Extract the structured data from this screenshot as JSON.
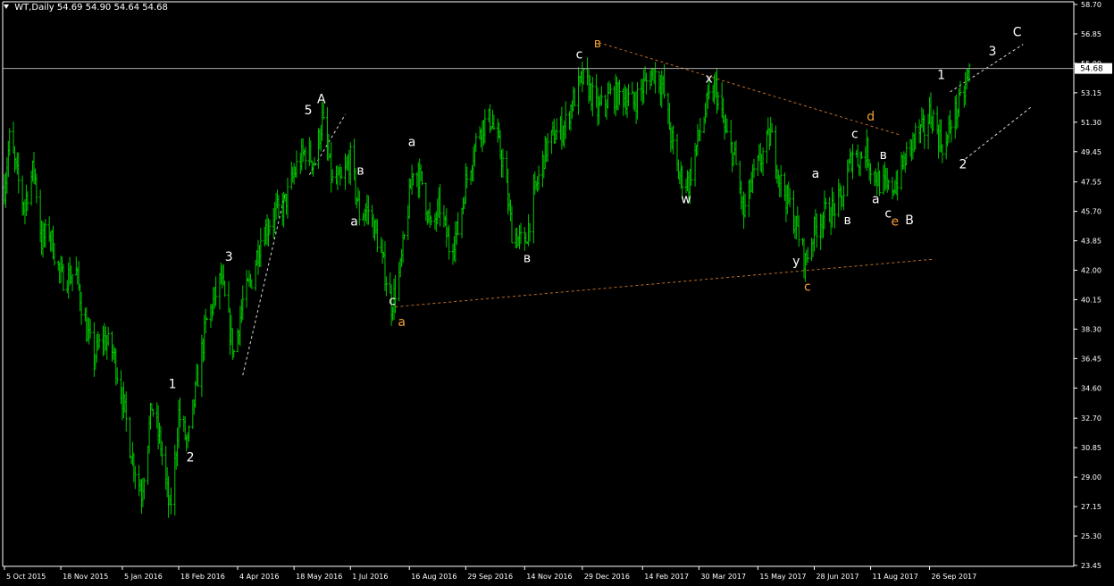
{
  "header": {
    "symbol": "WT,Daily",
    "quote": "54.69 54.90 54.64 54.68"
  },
  "current_price": {
    "label": "54.68",
    "value": 54.68
  },
  "colors": {
    "background": "#000000",
    "candles": "#00c800",
    "axis": "#ffffff",
    "text": "#ffffff",
    "wave_white": "#ffffff",
    "wave_orange": "#f0a030",
    "orange_trend": "#e08030"
  },
  "chart_data": {
    "type": "line",
    "title": "",
    "xlabel": "",
    "ylabel": "",
    "ylim": [
      23.45,
      58.7
    ],
    "y_ticks": [
      58.7,
      56.85,
      55.0,
      53.15,
      51.3,
      49.45,
      47.55,
      45.7,
      43.85,
      42.0,
      40.15,
      38.3,
      36.45,
      34.6,
      32.7,
      30.85,
      29.0,
      27.15,
      25.3,
      23.45
    ],
    "y_tick_labels": [
      "58.70",
      "56.85",
      "55.00",
      "53.15",
      "51.30",
      "49.45",
      "47.55",
      "45.70",
      "43.85",
      "42.00",
      "40.15",
      "38.30",
      "36.45",
      "34.60",
      "32.70",
      "30.85",
      "29.00",
      "27.15",
      "25.30",
      "23.45"
    ],
    "x_ticks": [
      "2015-10-05",
      "2015-11-18",
      "2016-01-05",
      "2016-02-18",
      "2016-04-04",
      "2016-05-18",
      "2016-07-01",
      "2016-08-16",
      "2016-09-29",
      "2016-11-14",
      "2016-12-29",
      "2017-02-14",
      "2017-03-30",
      "2017-05-15",
      "2017-06-28",
      "2017-08-11",
      "2017-09-26"
    ],
    "x_tick_labels": [
      "5 Oct 2015",
      "18 Nov 2015",
      "5 Jan 2016",
      "18 Feb 2016",
      "4 Apr 2016",
      "18 May 2016",
      "1 Jul 2016",
      "16 Aug 2016",
      "29 Sep 2016",
      "14 Nov 2016",
      "29 Dec 2016",
      "14 Feb 2017",
      "30 Mar 2017",
      "15 May 2017",
      "28 Jun 2017",
      "11 Aug 2017",
      "26 Sep 2017"
    ],
    "xlim": [
      "2015-10-05",
      "2017-10-27"
    ],
    "grid": false,
    "series": [
      {
        "style": "ohlc-bars",
        "points": [
          [
            "2015-10-05",
            47.2
          ],
          [
            "2015-10-09",
            50.2
          ],
          [
            "2015-10-20",
            46.0
          ],
          [
            "2015-10-28",
            48.5
          ],
          [
            "2015-11-03",
            43.8
          ],
          [
            "2015-11-09",
            44.5
          ],
          [
            "2015-11-18",
            41.5
          ],
          [
            "2015-11-30",
            41.8
          ],
          [
            "2015-12-07",
            38.5
          ],
          [
            "2015-12-14",
            36.5
          ],
          [
            "2015-12-21",
            37.8
          ],
          [
            "2015-12-29",
            36.8
          ],
          [
            "2016-01-05",
            34.0
          ],
          [
            "2016-01-12",
            30.5
          ],
          [
            "2016-01-20",
            28.0
          ],
          [
            "2016-01-28",
            33.5
          ],
          [
            "2016-02-04",
            31.0
          ],
          [
            "2016-02-11",
            26.8
          ],
          [
            "2016-02-15",
            29.8
          ],
          [
            "2016-02-18",
            33.0
          ],
          [
            "2016-02-25",
            31.0
          ],
          [
            "2016-03-03",
            34.8
          ],
          [
            "2016-03-10",
            38.5
          ],
          [
            "2016-03-22",
            41.5
          ],
          [
            "2016-04-01",
            36.8
          ],
          [
            "2016-04-08",
            40.0
          ],
          [
            "2016-04-15",
            41.5
          ],
          [
            "2016-04-22",
            44.0
          ],
          [
            "2016-05-02",
            45.5
          ],
          [
            "2016-05-10",
            46.0
          ],
          [
            "2016-05-20",
            48.5
          ],
          [
            "2016-05-27",
            49.5
          ],
          [
            "2016-06-03",
            48.8
          ],
          [
            "2016-06-09",
            51.5
          ],
          [
            "2016-06-17",
            47.5
          ],
          [
            "2016-06-24",
            47.5
          ],
          [
            "2016-07-01",
            49.0
          ],
          [
            "2016-07-08",
            45.5
          ],
          [
            "2016-07-15",
            45.8
          ],
          [
            "2016-07-22",
            44.0
          ],
          [
            "2016-07-29",
            41.5
          ],
          [
            "2016-08-02",
            39.8
          ],
          [
            "2016-08-09",
            42.0
          ],
          [
            "2016-08-16",
            46.5
          ],
          [
            "2016-08-19",
            48.5
          ],
          [
            "2016-08-26",
            47.5
          ],
          [
            "2016-09-02",
            44.5
          ],
          [
            "2016-09-09",
            46.0
          ],
          [
            "2016-09-16",
            43.5
          ],
          [
            "2016-09-23",
            44.5
          ],
          [
            "2016-09-29",
            47.5
          ],
          [
            "2016-10-10",
            51.0
          ],
          [
            "2016-10-19",
            51.5
          ],
          [
            "2016-10-28",
            48.8
          ],
          [
            "2016-11-04",
            44.5
          ],
          [
            "2016-11-14",
            43.5
          ],
          [
            "2016-11-21",
            46.5
          ],
          [
            "2016-11-30",
            49.5
          ],
          [
            "2016-12-07",
            50.5
          ],
          [
            "2016-12-15",
            51.0
          ],
          [
            "2016-12-21",
            52.5
          ],
          [
            "2016-12-29",
            54.0
          ],
          [
            "2017-01-03",
            53.5
          ],
          [
            "2017-01-10",
            52.0
          ],
          [
            "2017-01-20",
            53.0
          ],
          [
            "2017-01-30",
            53.0
          ],
          [
            "2017-02-07",
            52.5
          ],
          [
            "2017-02-14",
            53.5
          ],
          [
            "2017-02-23",
            54.5
          ],
          [
            "2017-03-02",
            53.5
          ],
          [
            "2017-03-08",
            50.5
          ],
          [
            "2017-03-14",
            48.0
          ],
          [
            "2017-03-22",
            47.5
          ],
          [
            "2017-03-30",
            50.5
          ],
          [
            "2017-04-06",
            52.5
          ],
          [
            "2017-04-12",
            53.5
          ],
          [
            "2017-04-20",
            50.5
          ],
          [
            "2017-04-27",
            49.0
          ],
          [
            "2017-05-04",
            45.5
          ],
          [
            "2017-05-10",
            47.5
          ],
          [
            "2017-05-15",
            48.5
          ],
          [
            "2017-05-25",
            50.5
          ],
          [
            "2017-06-02",
            47.5
          ],
          [
            "2017-06-09",
            46.0
          ],
          [
            "2017-06-15",
            44.5
          ],
          [
            "2017-06-21",
            42.5
          ],
          [
            "2017-06-28",
            44.5
          ],
          [
            "2017-07-05",
            45.5
          ],
          [
            "2017-07-12",
            45.8
          ],
          [
            "2017-07-20",
            46.5
          ],
          [
            "2017-07-28",
            49.5
          ],
          [
            "2017-08-01",
            49.0
          ],
          [
            "2017-08-08",
            49.5
          ],
          [
            "2017-08-11",
            48.5
          ],
          [
            "2017-08-18",
            47.5
          ],
          [
            "2017-08-25",
            47.0
          ],
          [
            "2017-08-31",
            47.5
          ],
          [
            "2017-09-07",
            49.0
          ],
          [
            "2017-09-15",
            50.5
          ],
          [
            "2017-09-22",
            50.8
          ],
          [
            "2017-09-26",
            51.8
          ],
          [
            "2017-09-29",
            51.5
          ],
          [
            "2017-10-05",
            50.0
          ],
          [
            "2017-10-09",
            49.8
          ],
          [
            "2017-10-13",
            51.5
          ],
          [
            "2017-10-17",
            52.0
          ],
          [
            "2017-10-20",
            52.5
          ],
          [
            "2017-10-24",
            53.5
          ],
          [
            "2017-10-27",
            54.6
          ]
        ]
      }
    ],
    "annotations": [
      {
        "text": "1",
        "color": "white",
        "x": "2016-02-10",
        "y": 34.6
      },
      {
        "text": "2",
        "color": "white",
        "x": "2016-02-24",
        "y": 30.0
      },
      {
        "text": "3",
        "color": "white",
        "x": "2016-03-25",
        "y": 42.6
      },
      {
        "text": "5",
        "color": "white",
        "x": "2016-05-26",
        "y": 51.8
      },
      {
        "text": "A",
        "color": "white",
        "x": "2016-06-05",
        "y": 52.5
      },
      {
        "text": "в",
        "color": "white",
        "x": "2016-07-06",
        "y": 48.0
      },
      {
        "text": "a",
        "color": "white",
        "x": "2016-07-01",
        "y": 44.8
      },
      {
        "text": "c",
        "color": "white",
        "x": "2016-07-31",
        "y": 39.8
      },
      {
        "text": "a",
        "color": "orange",
        "x": "2016-08-07",
        "y": 38.5
      },
      {
        "text": "a",
        "color": "white",
        "x": "2016-08-15",
        "y": 49.8
      },
      {
        "text": "в",
        "color": "white",
        "x": "2016-11-13",
        "y": 42.5
      },
      {
        "text": "c",
        "color": "white",
        "x": "2016-12-24",
        "y": 55.3
      },
      {
        "text": "в",
        "color": "orange",
        "x": "2017-01-07",
        "y": 56.0
      },
      {
        "text": "x",
        "color": "white",
        "x": "2017-04-04",
        "y": 53.8
      },
      {
        "text": "w",
        "color": "white",
        "x": "2017-03-16",
        "y": 46.2
      },
      {
        "text": "y",
        "color": "white",
        "x": "2017-06-11",
        "y": 42.3
      },
      {
        "text": "c",
        "color": "orange",
        "x": "2017-06-20",
        "y": 40.7
      },
      {
        "text": "a",
        "color": "white",
        "x": "2017-06-26",
        "y": 47.8
      },
      {
        "text": "в",
        "color": "white",
        "x": "2017-07-21",
        "y": 44.9
      },
      {
        "text": "c",
        "color": "white",
        "x": "2017-07-27",
        "y": 50.3
      },
      {
        "text": "d",
        "color": "orange",
        "x": "2017-08-08",
        "y": 51.4
      },
      {
        "text": "в",
        "color": "white",
        "x": "2017-08-18",
        "y": 49.0
      },
      {
        "text": "a",
        "color": "white",
        "x": "2017-08-12",
        "y": 46.2
      },
      {
        "text": "c",
        "color": "white",
        "x": "2017-08-22",
        "y": 45.3
      },
      {
        "text": "e",
        "color": "orange",
        "x": "2017-08-27",
        "y": 44.8
      },
      {
        "text": "B",
        "color": "white",
        "x": "2017-09-07",
        "y": 44.9
      },
      {
        "text": "1",
        "color": "white",
        "x": "2017-10-02",
        "y": 54.0
      },
      {
        "text": "2",
        "color": "white",
        "x": "2017-10-19",
        "y": 48.4
      },
      {
        "text": "3",
        "color": "white",
        "x": "2017-11-11",
        "y": 55.5
      },
      {
        "text": "C",
        "color": "white",
        "x": "2017-11-30",
        "y": 56.7
      }
    ],
    "trendlines": [
      {
        "color": "orange",
        "style": "dashed",
        "from": [
          "2017-01-11",
          56.3
        ],
        "to": [
          "2017-09-03",
          50.5
        ]
      },
      {
        "color": "orange",
        "style": "dashed",
        "from": [
          "2016-08-05",
          39.7
        ],
        "to": [
          "2017-09-30",
          42.7
        ]
      },
      {
        "color": "white",
        "style": "dashed",
        "from": [
          "2016-04-08",
          35.4
        ],
        "to": [
          "2016-05-11",
          46.8
        ]
      },
      {
        "color": "white",
        "style": "dashed",
        "from": [
          "2016-05-30",
          48.0
        ],
        "to": [
          "2016-06-27",
          51.8
        ]
      },
      {
        "color": "white",
        "style": "dashed",
        "from": [
          "2017-10-12",
          53.2
        ],
        "to": [
          "2017-12-08",
          56.2
        ]
      },
      {
        "color": "white",
        "style": "dashed",
        "from": [
          "2017-10-24",
          49.0
        ],
        "to": [
          "2017-12-15",
          52.3
        ]
      }
    ]
  }
}
